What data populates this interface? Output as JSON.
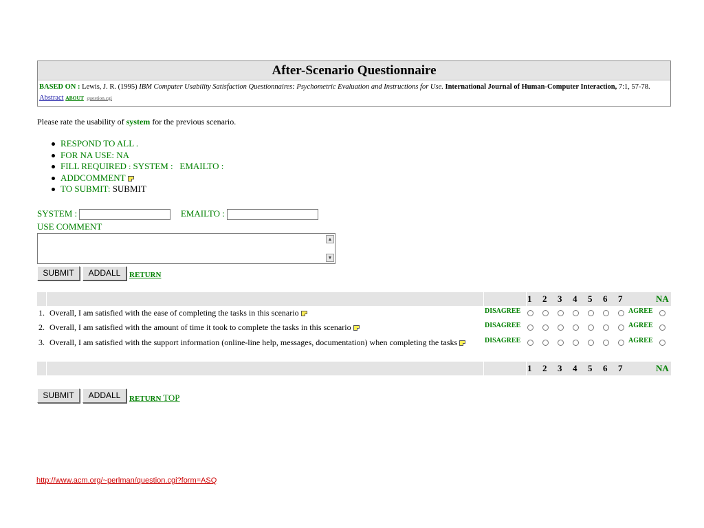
{
  "header": {
    "title": "After-Scenario Questionnaire",
    "based_on_label": "BASED ON :",
    "citation_author": "Lewis, J. R. (1995)",
    "citation_title": "IBM Computer Usability Satisfaction Questionnaires: Psychometric Evaluation and Instructions for Use.",
    "citation_journal": "International Journal of Human-Computer Interaction,",
    "citation_volume": "7:1, 57-78.",
    "abstract_link": "Abstract",
    "about_link": "ABOUT",
    "source_link": "question.cgi"
  },
  "intro": {
    "prefix": "Please rate the usability of",
    "system_word": "system",
    "suffix": "for the previous scenario."
  },
  "instructions": {
    "respond_all": "RESPOND TO ALL",
    "respond_all_dot": ".",
    "for_na": "FOR NA USE: NA",
    "fill_required_prefix": "FILL REQUIRED",
    "fill_required_sep": ":",
    "fill_required_fields": "SYSTEM :   EMAILTO :",
    "add_comment": "ADDCOMMENT",
    "to_submit_label": "TO SUBMIT:",
    "to_submit_value": "SUBMIT"
  },
  "form": {
    "system_label": "SYSTEM :",
    "system_value": "",
    "emailto_label": "EMAILTO :",
    "emailto_value": "",
    "comment_label": "USE COMMENT",
    "comment_value": ""
  },
  "buttons": {
    "submit": "SUBMIT",
    "addall": "ADDALL",
    "return": "RETURN",
    "return_top_a": "RETURN",
    "return_top_b": "TOP"
  },
  "table": {
    "scale": [
      "1",
      "2",
      "3",
      "4",
      "5",
      "6",
      "7"
    ],
    "na": "NA",
    "disagree": "DISAGREE",
    "agree": "AGREE",
    "questions": [
      {
        "num": "1.",
        "text": "Overall, I am satisfied with the ease of completing the tasks in this scenario"
      },
      {
        "num": "2.",
        "text": "Overall, I am satisfied with the amount of time it took to complete the tasks in this scenario"
      },
      {
        "num": "3.",
        "text": "Overall, I am satisfied with the support information (online-line help, messages, documentation) when completing the tasks"
      }
    ]
  },
  "footer": {
    "url": "http://www.acm.org/~perlman/question.cgi?form=ASQ"
  },
  "colors": {
    "green": "#008000",
    "header_bg": "#e4e4e4",
    "footer_link": "#cc0000"
  }
}
